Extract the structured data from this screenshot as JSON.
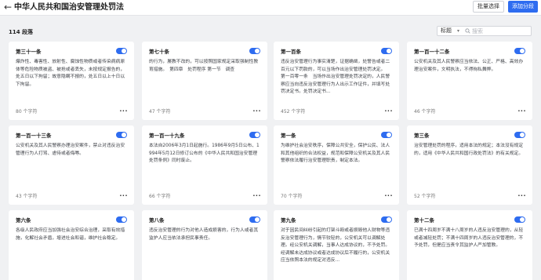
{
  "header": {
    "back_icon": "back-arrow-icon",
    "title": "中华人民共和国治安管理处罚法",
    "batch_select_label": "批量选择",
    "add_segment_label": "添加分段",
    "accent_color": "#2e6cf0"
  },
  "toolbar": {
    "count_label": "114 段落",
    "filter_value": "标题",
    "search_placeholder": "搜索"
  },
  "cards": [
    {
      "title": "第三十一条",
      "body": "爆炸性、毒害性、放射性、腐蚀性物质或者传染病病原体等危险物质被盗、被抢或者丢失，未按规定报告的，处五日以下拘留；故意隐瞒不报的，处五日以上十日以下拘留。",
      "chars": "80 个字符",
      "enabled": true
    },
    {
      "title": "第七十条",
      "body": "的行为，屡教不改的，可以按照国家规定采取强制性教育措施。　第四章　处罚程序 第一节　调查",
      "chars": "47 个字符",
      "enabled": true
    },
    {
      "title": "第一百条",
      "body": "违反治安管理行为事实清楚，证据确凿，处警告或者二百元以下罚款的，可以当场作出治安管理处罚决定。　　第一百零一条　当场作出治安管理处罚决定的，人民警察应当向违反治安管理行为人出示工作证件，并填写处罚决定书。处罚决定书...",
      "chars": "452 个字符",
      "enabled": true
    },
    {
      "title": "第一百一十二条",
      "body": "公安机关及其人民警察应当依法、公正、严格、高效办理治安案件，文明执法，不得徇私舞弊。",
      "chars": "46 个字符",
      "enabled": true
    },
    {
      "title": "第一百一十三条",
      "body": "公安机关及其人民警察办理治安案件，禁止对违反治安管理行为人打骂、虐待或者侮辱。",
      "chars": "43 个字符",
      "enabled": true
    },
    {
      "title": "第一百一十九条",
      "body": "本法自2006年3月1日起施行。1986年9月5日公布、1994年5月12日修订公布的《中华人民共和国治安管理处罚条例》同时废止。",
      "chars": "66 个字符",
      "enabled": true
    },
    {
      "title": "第一条",
      "body": "为维护社会治安秩序，保障公共安全，保护公民、法人和其他组织的合法权益，规范和保障公安机关及其人民警察依法履行治安管理职责，制定本法。",
      "chars": "70 个字符",
      "enabled": true
    },
    {
      "title": "第三条",
      "body": "治安管理处罚的程序，适用本法的规定；本法没有规定的，适用《中华人民共和国行政处罚法》的有关规定。",
      "chars": "52 个字符",
      "enabled": true
    },
    {
      "title": "第六条",
      "body": "各级人民政府应当加强社会治安综合治理，采取有效措施，化解社会矛盾，增进社会和谐，维护社会稳定。",
      "chars": "",
      "enabled": true
    },
    {
      "title": "第八条",
      "body": "违反治安管理的行为对他人造成损害的，行为人或者其监护人应当依法承担民事责任。",
      "chars": "",
      "enabled": true
    },
    {
      "title": "第九条",
      "body": "对于因民间纠纷引起的打架斗殴或者损毁他人财物等违反治安管理行为，情节较轻的，公安机关可以调解处理。经公安机关调解，当事人达成协议的，不予处罚。经调解未达成协议或者达成协议后不履行的，公安机关应当依照本法的规定对违反...",
      "chars": "",
      "enabled": true
    },
    {
      "title": "第十二条",
      "body": "已满十四周岁不满十八周岁的人违反治安管理的，从轻或者减轻处罚；不满十四周岁的人违反治安管理的，不予处罚，但是应当责令其监护人严加管教。",
      "chars": "",
      "enabled": true
    }
  ]
}
